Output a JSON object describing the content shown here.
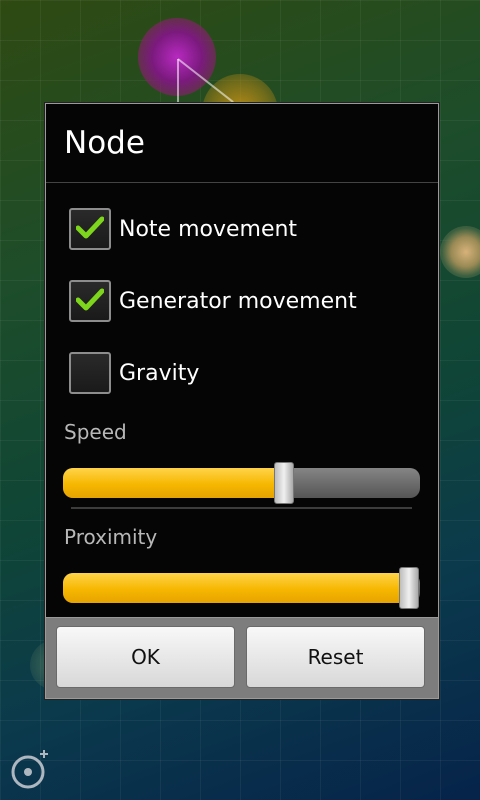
{
  "background": {
    "icons": {
      "bottom_left": "add-node-icon"
    }
  },
  "dialog": {
    "title": "Node",
    "checkboxes": [
      {
        "label": "Note movement",
        "checked": true
      },
      {
        "label": "Generator movement",
        "checked": true
      },
      {
        "label": "Gravity",
        "checked": false
      }
    ],
    "sliders": [
      {
        "label": "Speed",
        "value_percent": 62
      },
      {
        "label": "Proximity",
        "value_percent": 97
      }
    ],
    "buttons": {
      "ok_label": "OK",
      "reset_label": "Reset"
    },
    "colors": {
      "accent": "#f6b700",
      "check": "#7dd51c"
    }
  }
}
